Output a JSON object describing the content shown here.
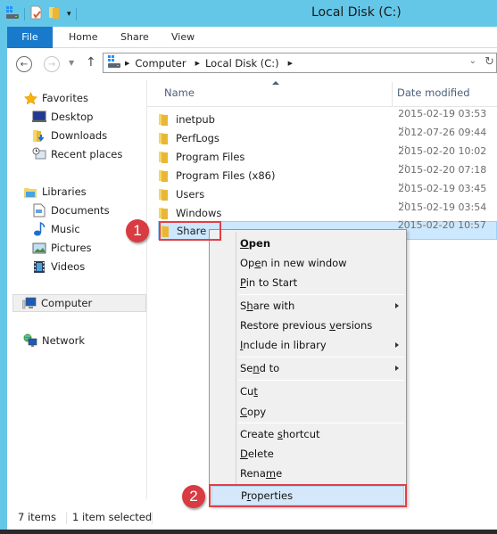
{
  "window": {
    "title": "Local Disk (C:)"
  },
  "quick_access": {
    "icons": [
      "drive-icon",
      "properties-icon",
      "new-folder-icon",
      "customize-dropdown-icon"
    ]
  },
  "ribbon": {
    "tabs": [
      {
        "label": "File",
        "active": true
      },
      {
        "label": "Home"
      },
      {
        "label": "Share"
      },
      {
        "label": "View"
      }
    ]
  },
  "navigation": {
    "back_icon": "back-arrow-icon",
    "forward_icon": "forward-arrow-icon",
    "recent_icon": "chevron-down-icon",
    "up_icon": "up-arrow-icon",
    "address": {
      "crumbs": [
        "Computer",
        "Local Disk (C:)"
      ]
    }
  },
  "sidebar": {
    "groups": [
      {
        "label": "Favorites",
        "icon": "star-icon",
        "items": [
          {
            "label": "Desktop",
            "icon": "desktop-icon"
          },
          {
            "label": "Downloads",
            "icon": "downloads-icon"
          },
          {
            "label": "Recent places",
            "icon": "recent-places-icon"
          }
        ]
      },
      {
        "label": "Libraries",
        "icon": "libraries-icon",
        "items": [
          {
            "label": "Documents",
            "icon": "documents-icon"
          },
          {
            "label": "Music",
            "icon": "music-icon"
          },
          {
            "label": "Pictures",
            "icon": "pictures-icon"
          },
          {
            "label": "Videos",
            "icon": "videos-icon"
          }
        ]
      },
      {
        "label": "Computer",
        "icon": "computer-icon",
        "selected": true
      },
      {
        "label": "Network",
        "icon": "network-icon"
      }
    ]
  },
  "file_list": {
    "columns": [
      "Name",
      "Date modified"
    ],
    "rows": [
      {
        "name": "inetpub",
        "date": "2015-02-19 03:53 ..."
      },
      {
        "name": "PerfLogs",
        "date": "2012-07-26 09:44 ..."
      },
      {
        "name": "Program Files",
        "date": "2015-02-20 10:02 ..."
      },
      {
        "name": "Program Files (x86)",
        "date": "2015-02-20 07:18 ..."
      },
      {
        "name": "Users",
        "date": "2015-02-19 03:45 ..."
      },
      {
        "name": "Windows",
        "date": "2015-02-19 03:54 ..."
      },
      {
        "name": "Share",
        "date": "2015-02-20 10:57 ...",
        "selected": true
      }
    ]
  },
  "context_menu": {
    "items": [
      {
        "pre": "",
        "u": "O",
        "post": "pen",
        "bold": true
      },
      {
        "pre": "Op",
        "u": "e",
        "post": "n in new window"
      },
      {
        "pre": "",
        "u": "P",
        "post": "in to Start"
      },
      {
        "pre": "S",
        "u": "h",
        "post": "are with",
        "submenu": true
      },
      {
        "pre": "Restore previous ",
        "u": "v",
        "post": "ersions"
      },
      {
        "pre": "",
        "u": "I",
        "post": "nclude in library",
        "submenu": true
      },
      {
        "pre": "Se",
        "u": "n",
        "post": "d to",
        "submenu": true
      },
      {
        "pre": "Cu",
        "u": "t",
        "post": ""
      },
      {
        "pre": "",
        "u": "C",
        "post": "opy"
      },
      {
        "pre": "Create ",
        "u": "s",
        "post": "hortcut"
      },
      {
        "pre": "",
        "u": "D",
        "post": "elete"
      },
      {
        "pre": "Rena",
        "u": "m",
        "post": "e"
      },
      {
        "pre": "P",
        "u": "r",
        "post": "operties",
        "highlighted": true
      }
    ]
  },
  "annotations": {
    "step1": "1",
    "step2": "2",
    "color": "#d83b42"
  },
  "status_bar": {
    "item_count": "7 items",
    "selection": "1 item selected"
  }
}
